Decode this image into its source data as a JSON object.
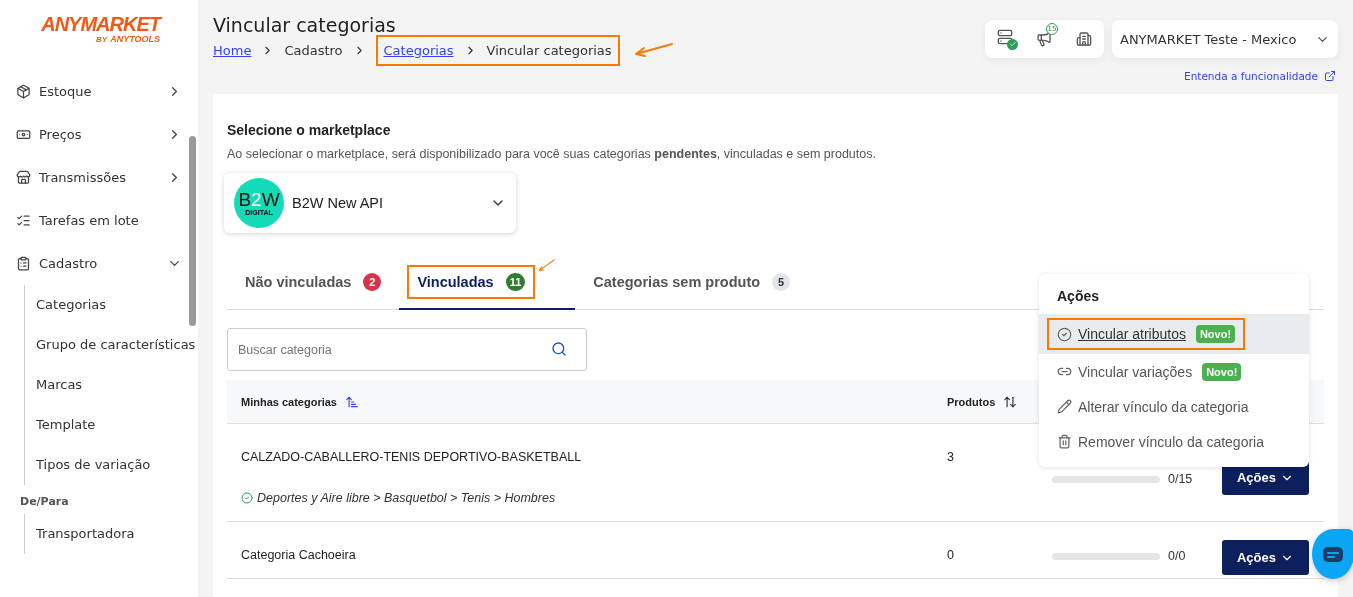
{
  "logo": {
    "name": "ANYMARKET",
    "byline": "BY",
    "brand": "ANYTOOLS"
  },
  "sidebar": {
    "items": [
      {
        "kind": "menu",
        "label": "Estoque",
        "expandable": true,
        "expanded": false
      },
      {
        "kind": "menu",
        "label": "Preços",
        "expandable": true,
        "expanded": false
      },
      {
        "kind": "menu",
        "label": "Transmissões",
        "expandable": true,
        "expanded": false
      },
      {
        "kind": "menu",
        "label": "Tarefas em lote",
        "expandable": false
      },
      {
        "kind": "menu",
        "label": "Cadastro",
        "expandable": true,
        "expanded": true,
        "children": [
          {
            "label": "Categorias"
          },
          {
            "label": "Grupo de características"
          },
          {
            "label": "Marcas"
          },
          {
            "label": "Template"
          },
          {
            "label": "Tipos de variação"
          }
        ]
      },
      {
        "kind": "section",
        "label": "De/Para",
        "children": [
          {
            "label": "Transportadora"
          }
        ]
      }
    ]
  },
  "header": {
    "title": "Vincular categorias",
    "breadcrumb": [
      {
        "kind": "crumb",
        "label": "Home",
        "link": true
      },
      {
        "kind": "crumb",
        "label": "Cadastro",
        "link": false
      },
      {
        "kind": "annotated_group",
        "items": [
          {
            "label": "Categorias",
            "link": true
          },
          {
            "label": "Vincular categorias",
            "link": false
          }
        ]
      }
    ]
  },
  "toolbar": {
    "notification_count": "15",
    "account": "ANYMARKET Teste - Mexico"
  },
  "help_link": "Entenda a funcionalidade",
  "marketplace": {
    "heading": "Selecione o marketplace",
    "description": "Ao selecionar o marketplace, será disponibilizado para você suas categorias **pendentes**, vinculadas e sem produtos.",
    "logo": {
      "parts": [
        {
          "text": "B",
          "color": "#111111"
        },
        {
          "text": "2",
          "color": "#ffffff"
        },
        {
          "text": "W",
          "color": "#111111"
        }
      ],
      "sub": "DIGITAL"
    },
    "name": "B2W New API"
  },
  "tabs": [
    {
      "label": "Não vinculadas",
      "count": "2",
      "color": "#d7334a",
      "selected": false,
      "highlighted": false
    },
    {
      "label": "Vinculadas",
      "count": "11",
      "color": "#2e7d32",
      "selected": true,
      "highlighted": true
    },
    {
      "label": "Categorias sem produto",
      "count": "5",
      "color": "#e2e5ea",
      "selected": false,
      "highlighted": false
    }
  ],
  "search": {
    "placeholder": "Buscar categoria"
  },
  "table": {
    "columns": [
      {
        "label": "Minhas categorias"
      },
      {
        "label": "Produtos"
      }
    ],
    "rows": [
      {
        "name": "CALZADO-CABALLERO-TENIS DEPORTIVO-BASKETBALL",
        "products": "3",
        "linked_path": "Deportes y Aire libre > Basquetbol > Tenis > Hombres",
        "progress": "0/15",
        "level": 0,
        "action": "Ações"
      },
      {
        "name": "Categoria Cachoeira",
        "products": "0",
        "progress": "0/0",
        "level": 0,
        "action": "Ações"
      }
    ]
  },
  "actions_menu": {
    "title": "Ações",
    "items": [
      {
        "label": "Vincular atributos",
        "badge": "Novo!",
        "hovered": true,
        "highlighted": true
      },
      {
        "label": "Vincular variações",
        "badge": "Novo!",
        "hovered": false,
        "highlighted": false
      },
      {
        "label": "Alterar vínculo da categoria",
        "hovered": false,
        "highlighted": false
      },
      {
        "label": "Remover vínculo da categoria",
        "hovered": false,
        "highlighted": false
      }
    ]
  }
}
